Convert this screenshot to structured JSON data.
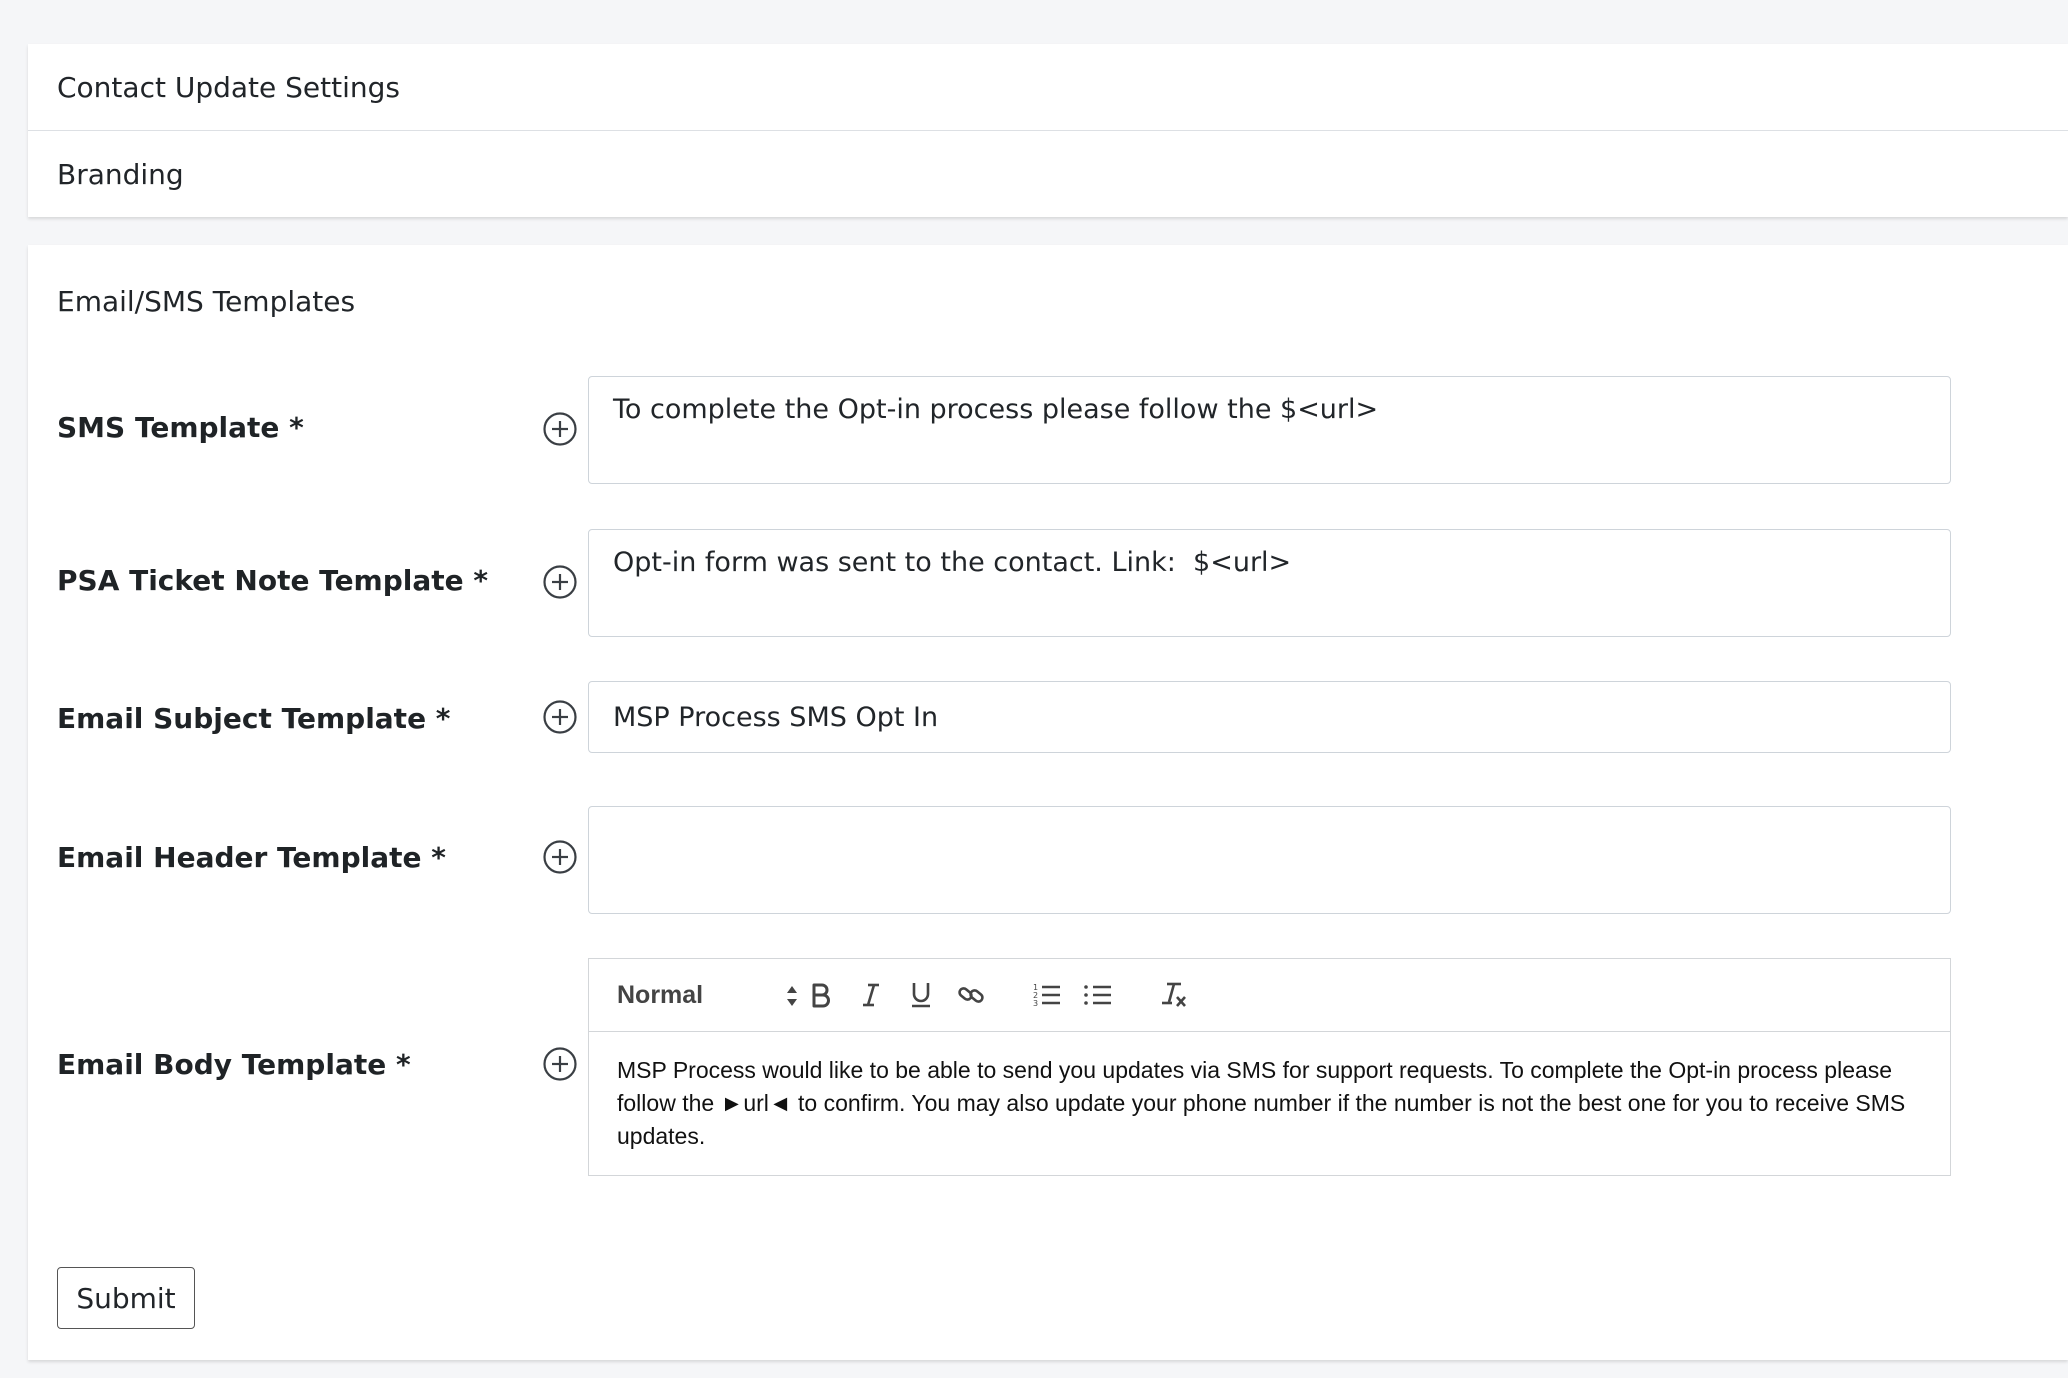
{
  "accordion": {
    "items": [
      {
        "label": "Contact Update Settings"
      },
      {
        "label": "Branding"
      }
    ]
  },
  "form": {
    "section_title": "Email/SMS Templates",
    "fields": {
      "sms": {
        "label": "SMS Template *",
        "value": "To complete the Opt-in process please follow the $<url>"
      },
      "psa": {
        "label": "PSA Ticket Note Template *",
        "value": "Opt-in form was sent to the contact. Link:  $<url>"
      },
      "email_subject": {
        "label": "Email Subject Template *",
        "value": "MSP Process SMS Opt In"
      },
      "email_header": {
        "label": "Email Header Template *",
        "value": ""
      },
      "email_body": {
        "label": "Email Body Template *",
        "format": "Normal",
        "value": "MSP Process would like to be able to send you updates via SMS for support requests. To complete the Opt-in process please follow the ►url◄ to confirm. You may also update your phone number if the number is not the best one for you to receive SMS updates."
      }
    },
    "submit_label": "Submit"
  },
  "icons": {
    "add": "plus-circle-icon",
    "bold": "bold-icon",
    "italic": "italic-icon",
    "underline": "underline-icon",
    "link": "link-icon",
    "ordered_list": "ordered-list-icon",
    "bullet_list": "bullet-list-icon",
    "clean": "clear-format-icon"
  },
  "colors": {
    "background": "#f5f6f8",
    "card": "#ffffff",
    "border": "#ced4da",
    "text": "#212529"
  }
}
